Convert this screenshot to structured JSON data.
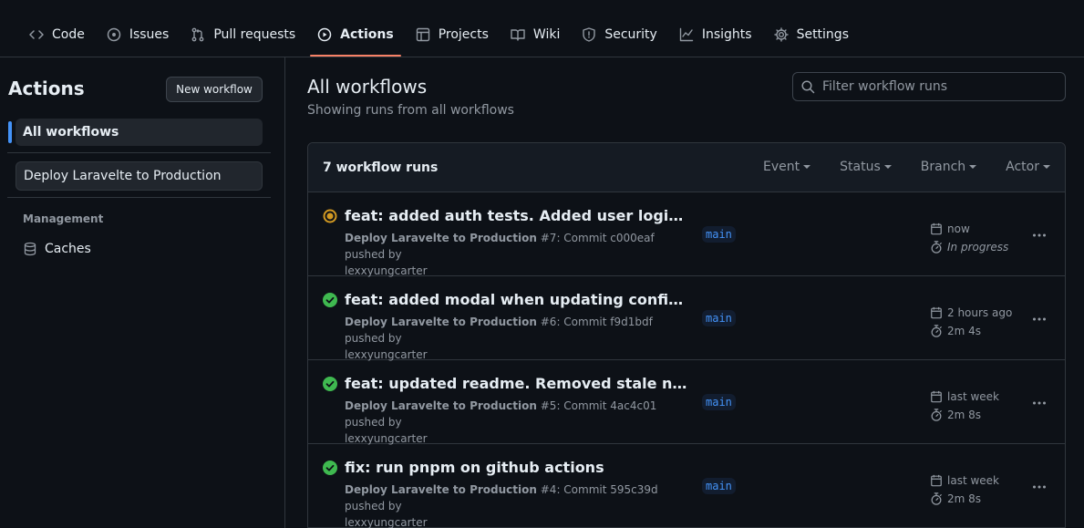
{
  "tabs": [
    {
      "label": "Code",
      "icon": "code-icon"
    },
    {
      "label": "Issues",
      "icon": "issue-icon"
    },
    {
      "label": "Pull requests",
      "icon": "pull-request-icon"
    },
    {
      "label": "Actions",
      "icon": "play-icon",
      "active": true
    },
    {
      "label": "Projects",
      "icon": "table-icon"
    },
    {
      "label": "Wiki",
      "icon": "book-icon"
    },
    {
      "label": "Security",
      "icon": "shield-icon"
    },
    {
      "label": "Insights",
      "icon": "graph-icon"
    },
    {
      "label": "Settings",
      "icon": "gear-icon"
    }
  ],
  "sidebar": {
    "title": "Actions",
    "new_workflow_label": "New workflow",
    "all_workflows_label": "All workflows",
    "workflow_item": "Deploy Laravelte to Production",
    "management_heading": "Management",
    "caches_label": "Caches"
  },
  "main": {
    "title": "All workflows",
    "subtitle": "Showing runs from all workflows",
    "filter_placeholder": "Filter workflow runs",
    "runs_count": "7 workflow runs",
    "filters": [
      "Event",
      "Status",
      "Branch",
      "Actor"
    ]
  },
  "runs": [
    {
      "title": "feat: added auth tests. Added user logins tra...",
      "workflow": "Deploy Laravelte to Production",
      "detail": " #7: Commit c000eaf pushed by",
      "actor": "lexxyungcarter",
      "branch": "main",
      "when": "now",
      "duration": "In progress",
      "status": "in-progress"
    },
    {
      "title": "feat: added modal when updating configurat...",
      "workflow": "Deploy Laravelte to Production",
      "detail": " #6: Commit f9d1bdf pushed by",
      "actor": "lexxyungcarter",
      "branch": "main",
      "when": "2 hours ago",
      "duration": "2m 4s",
      "status": "success"
    },
    {
      "title": "feat: updated readme. Removed stale npm p...",
      "workflow": "Deploy Laravelte to Production",
      "detail": " #5: Commit 4ac4c01 pushed by",
      "actor": "lexxyungcarter",
      "branch": "main",
      "when": "last week",
      "duration": "2m 8s",
      "status": "success"
    },
    {
      "title": "fix: run pnpm on github actions",
      "workflow": "Deploy Laravelte to Production",
      "detail": " #4: Commit 595c39d pushed by",
      "actor": "lexxyungcarter",
      "branch": "main",
      "when": "last week",
      "duration": "2m 8s",
      "status": "success"
    }
  ],
  "colors": {
    "background": "#0d1117",
    "accent_underline": "#f78166",
    "success": "#3fb950",
    "in_progress": "#d29922",
    "branch_text": "#4493f8"
  }
}
